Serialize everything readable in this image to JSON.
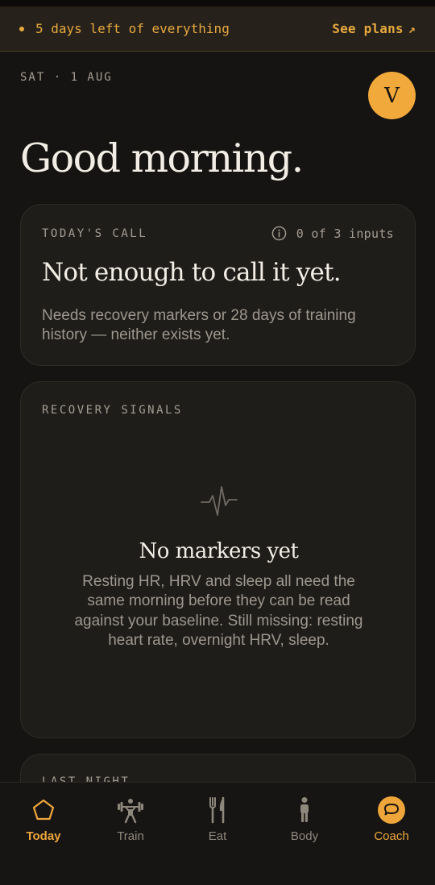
{
  "trial": {
    "text": "5 days left of everything",
    "cta": "See plans",
    "cta_icon": "arrow-up-right-icon"
  },
  "header": {
    "date": "SAT · 1 AUG",
    "avatar_initial": "V",
    "greeting": "Good morning."
  },
  "todays_call": {
    "label": "TODAY'S CALL",
    "inputs": "0 of 3 inputs",
    "title": "Not enough to call it yet.",
    "body": "Needs recovery markers or 28 days of training history — neither exists yet."
  },
  "recovery": {
    "label": "RECOVERY SIGNALS",
    "empty_title": "No markers yet",
    "empty_body": "Resting HR, HRV and sleep all need the same morning before they can be read against your baseline. Still missing: resting heart rate, overnight HRV, sleep."
  },
  "last_night": {
    "label": "LAST NIGHT"
  },
  "tabs": [
    {
      "label": "Today",
      "icon": "pentagon-icon",
      "active": true
    },
    {
      "label": "Train",
      "icon": "weightlifter-icon"
    },
    {
      "label": "Eat",
      "icon": "fork-knife-icon"
    },
    {
      "label": "Body",
      "icon": "person-icon"
    },
    {
      "label": "Coach",
      "icon": "chat-bubble-icon"
    }
  ],
  "colors": {
    "accent": "#EEA63B",
    "background": "#161412",
    "card": "#1F1D1A"
  }
}
